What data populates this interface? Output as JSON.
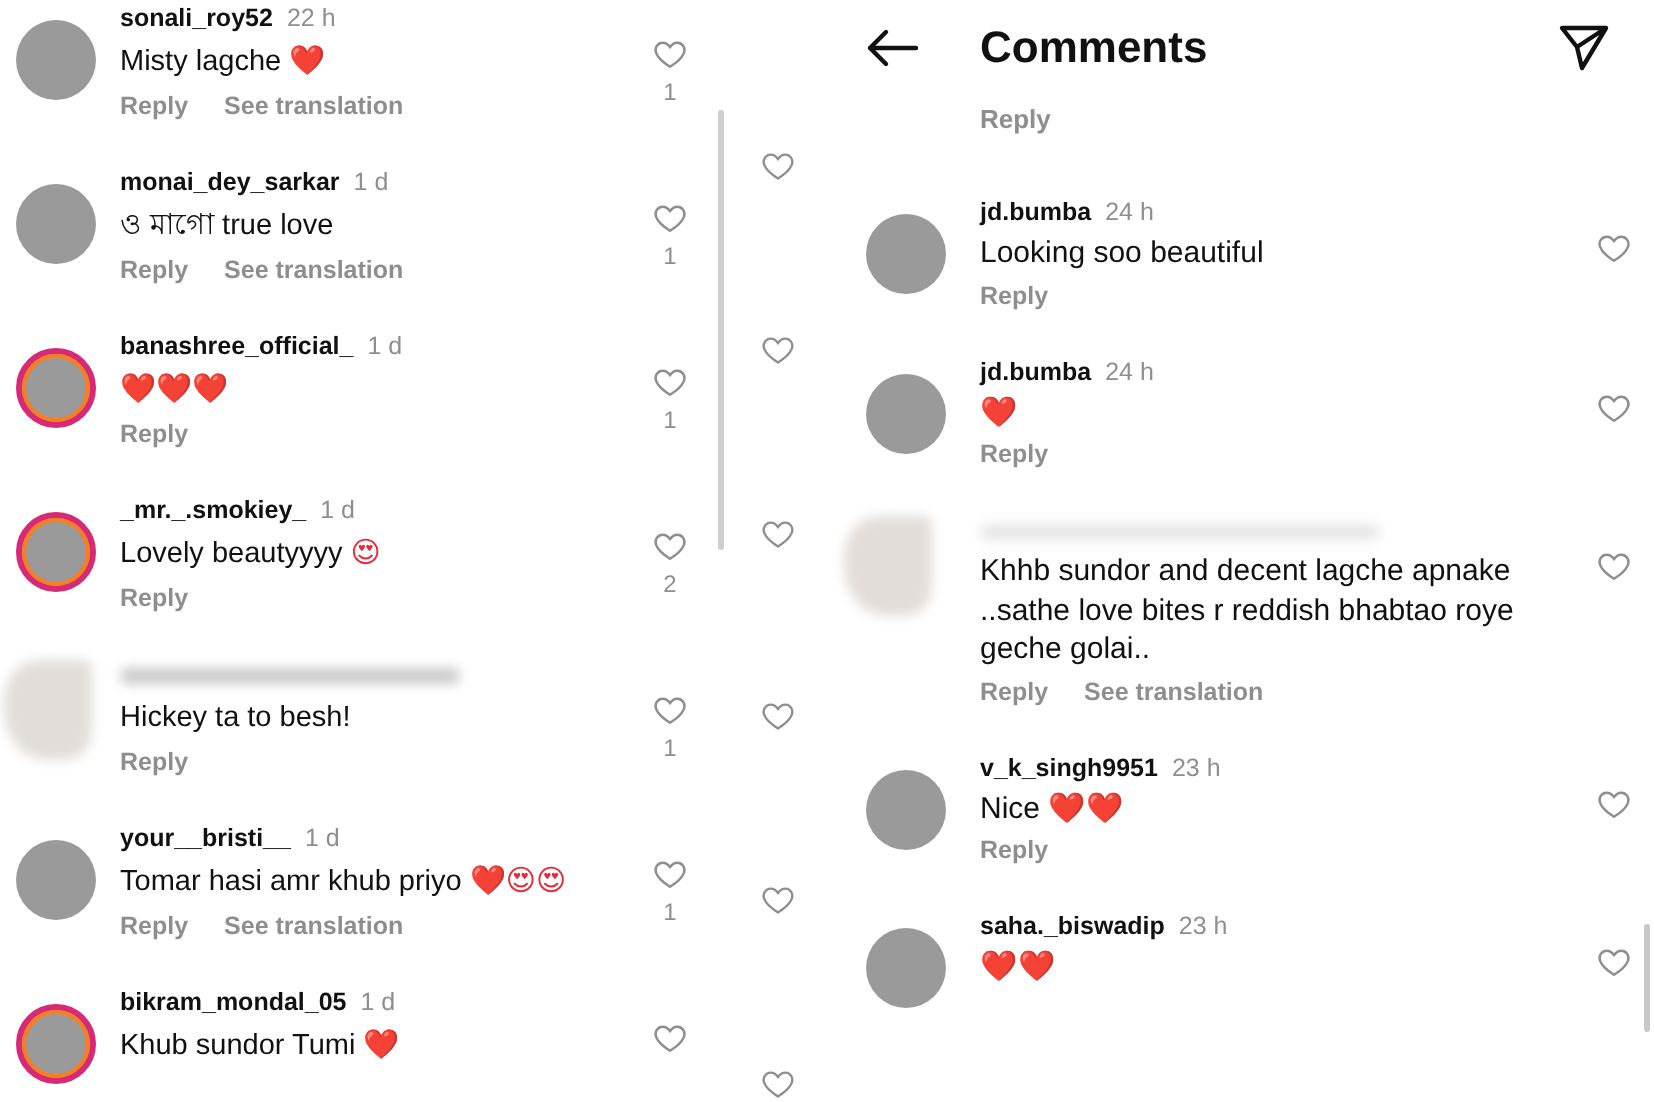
{
  "left_panel": {
    "comments": [
      {
        "username": "sonali_roy52",
        "time": "22 h",
        "text": "Misty lagche",
        "emoji": "❤️",
        "actions": [
          "Reply",
          "See translation"
        ],
        "likes": "1",
        "story_ring": false,
        "name_hidden": false
      },
      {
        "username": "monai_dey_sarkar",
        "time": "1 d",
        "text": "ও মাগো true love",
        "actions": [
          "Reply",
          "See translation"
        ],
        "likes": "1",
        "story_ring": false,
        "name_hidden": false
      },
      {
        "username": "banashree_official_",
        "time": "1 d",
        "emoji": "❤️❤️❤️",
        "actions": [
          "Reply"
        ],
        "likes": "1",
        "story_ring": true,
        "name_hidden": false
      },
      {
        "username": "_mr._.smokiey_",
        "time": "1 d",
        "text": "Lovely beautyyyy",
        "emoji": "😍",
        "actions": [
          "Reply"
        ],
        "likes": "2",
        "story_ring": true,
        "name_hidden": false
      },
      {
        "text": "Hickey ta to besh!",
        "actions": [
          "Reply"
        ],
        "likes": "1",
        "story_ring": false,
        "name_hidden": true
      },
      {
        "username": "your__bristi__",
        "time": "1 d",
        "text": "Tomar hasi amr khub priyo",
        "emoji": "❤️😍😍",
        "actions": [
          "Reply",
          "See translation"
        ],
        "likes": "1",
        "story_ring": false,
        "name_hidden": false
      },
      {
        "username": "bikram_mondal_05",
        "time": "1 d",
        "text": "Khub sundor Tumi",
        "emoji": "❤️",
        "story_ring": true,
        "name_hidden": false
      }
    ]
  },
  "background_strip": {
    "hearts": [
      {
        "liked": false
      },
      {
        "liked": false
      },
      {
        "liked": false
      },
      {
        "liked": false
      },
      {
        "liked": false
      },
      {
        "liked": false
      }
    ]
  },
  "right_panel": {
    "header": {
      "title": "Comments"
    },
    "orphan_reply": "Reply",
    "comments": [
      {
        "username": "jd.bumba",
        "time": "24 h",
        "text": "Looking soo beautiful",
        "actions": [
          "Reply"
        ],
        "story_ring": false,
        "name_hidden": false
      },
      {
        "username": "jd.bumba",
        "time": "24 h",
        "emoji": "❤️",
        "actions": [
          "Reply"
        ],
        "story_ring": false,
        "name_hidden": false
      },
      {
        "text": "Khhb sundor and decent lagche apnake ..sathe love bites r reddish bhabtao roye geche golai..",
        "actions": [
          "Reply",
          "See translation"
        ],
        "story_ring": false,
        "name_hidden": true
      },
      {
        "username": "v_k_singh9951",
        "time": "23 h",
        "text": "Nice",
        "emoji": "❤️❤️",
        "actions": [
          "Reply"
        ],
        "story_ring": false,
        "name_hidden": false
      },
      {
        "username": "saha._biswadip",
        "time": "23 h",
        "emoji": "❤️❤️",
        "story_ring": false,
        "name_hidden": false
      }
    ]
  }
}
